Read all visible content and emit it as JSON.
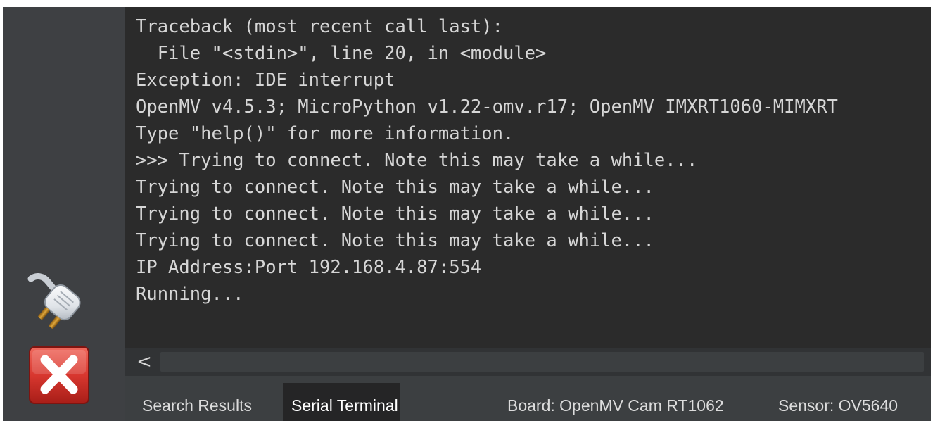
{
  "terminal": {
    "lines": [
      "Traceback (most recent call last):",
      "  File \"<stdin>\", line 20, in <module>",
      "Exception: IDE interrupt",
      "OpenMV v4.5.3; MicroPython v1.22-omv.r17; OpenMV IMXRT1060-MIMXRT",
      "Type \"help()\" for more information.",
      ">>> Trying to connect. Note this may take a while...",
      "Trying to connect. Note this may take a while...",
      "Trying to connect. Note this may take a while...",
      "Trying to connect. Note this may take a while...",
      "IP Address:Port 192.168.4.87:554",
      "Running..."
    ]
  },
  "toolbar": {
    "connect_icon": "plug-icon",
    "disconnect_icon": "red-x-icon"
  },
  "scrollbar": {
    "left_arrow": "<"
  },
  "tabs": {
    "search_results": "Search Results",
    "serial_terminal": "Serial Terminal"
  },
  "status": {
    "board": "Board: OpenMV Cam RT1062",
    "sensor": "Sensor: OV5640"
  },
  "colors": {
    "terminal_background": "#2b2b2b",
    "terminal_text": "#d6d6d6",
    "disconnect_red": "#d8372f",
    "active_tab": "#252526"
  }
}
